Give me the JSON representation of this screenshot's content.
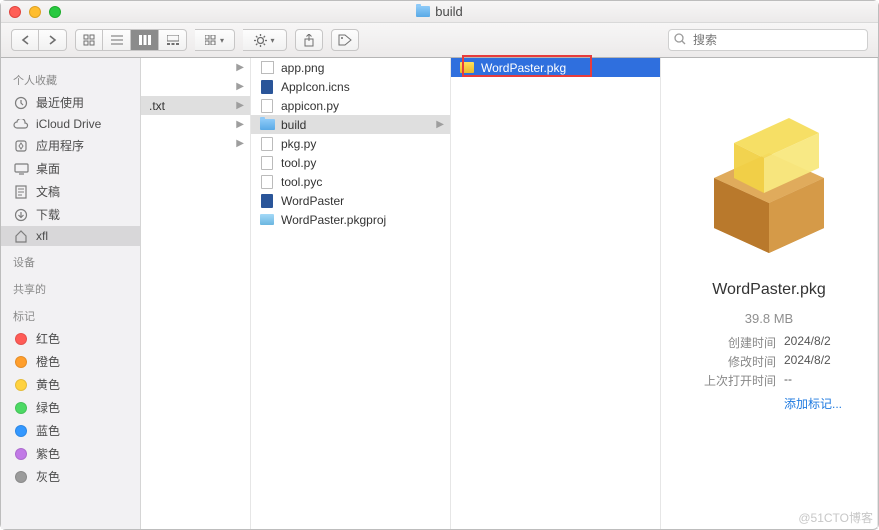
{
  "window": {
    "title": "build"
  },
  "toolbar": {
    "search_placeholder": "搜索"
  },
  "sidebar": {
    "sections": [
      {
        "header": "个人收藏",
        "items": [
          {
            "icon": "clock-icon",
            "label": "最近使用"
          },
          {
            "icon": "cloud-icon",
            "label": "iCloud Drive"
          },
          {
            "icon": "app-icon",
            "label": "应用程序"
          },
          {
            "icon": "desktop-icon",
            "label": "桌面"
          },
          {
            "icon": "doc-icon",
            "label": "文稿"
          },
          {
            "icon": "download-icon",
            "label": "下载"
          },
          {
            "icon": "home-icon",
            "label": "xfl",
            "selected": true
          }
        ]
      },
      {
        "header": "设备",
        "items": []
      },
      {
        "header": "共享的",
        "items": []
      },
      {
        "header": "标记",
        "items": [
          {
            "icon": "tag-dot",
            "color": "#ff5b56",
            "label": "红色"
          },
          {
            "icon": "tag-dot",
            "color": "#ff9e2c",
            "label": "橙色"
          },
          {
            "icon": "tag-dot",
            "color": "#ffd23f",
            "label": "黄色"
          },
          {
            "icon": "tag-dot",
            "color": "#4cd964",
            "label": "绿色"
          },
          {
            "icon": "tag-dot",
            "color": "#3498ff",
            "label": "蓝色"
          },
          {
            "icon": "tag-dot",
            "color": "#c179e6",
            "label": "紫色"
          },
          {
            "icon": "tag-dot",
            "color": "#9b9b9b",
            "label": "灰色"
          }
        ]
      }
    ]
  },
  "col1": {
    "items": [
      {
        "label": "",
        "arrow": true
      },
      {
        "label": "",
        "arrow": true
      },
      {
        "label": ".txt",
        "selected": true,
        "arrow": true
      },
      {
        "label": "",
        "arrow": true
      },
      {
        "label": "",
        "arrow": true
      }
    ]
  },
  "col2": {
    "items": [
      {
        "icon": "img",
        "label": "app.png"
      },
      {
        "icon": "word",
        "label": "AppIcon.icns"
      },
      {
        "icon": "doc",
        "label": "appicon.py"
      },
      {
        "icon": "folder",
        "label": "build",
        "selected": true,
        "arrow": true
      },
      {
        "icon": "doc",
        "label": "pkg.py"
      },
      {
        "icon": "doc",
        "label": "tool.py"
      },
      {
        "icon": "doc",
        "label": "tool.pyc"
      },
      {
        "icon": "word",
        "label": "WordPaster"
      },
      {
        "icon": "proj",
        "label": "WordPaster.pkgproj"
      }
    ]
  },
  "col3": {
    "items": [
      {
        "icon": "pkg",
        "label": "WordPaster.pkg",
        "highlighted": true
      }
    ]
  },
  "preview": {
    "name": "WordPaster.pkg",
    "size": "39.8 MB",
    "created_label": "创建时间",
    "created_value": "2024/8/2",
    "modified_label": "修改时间",
    "modified_value": "2024/8/2",
    "opened_label": "上次打开时间",
    "opened_value": "--",
    "add_tags": "添加标记..."
  },
  "watermark": "@51CTO博客"
}
